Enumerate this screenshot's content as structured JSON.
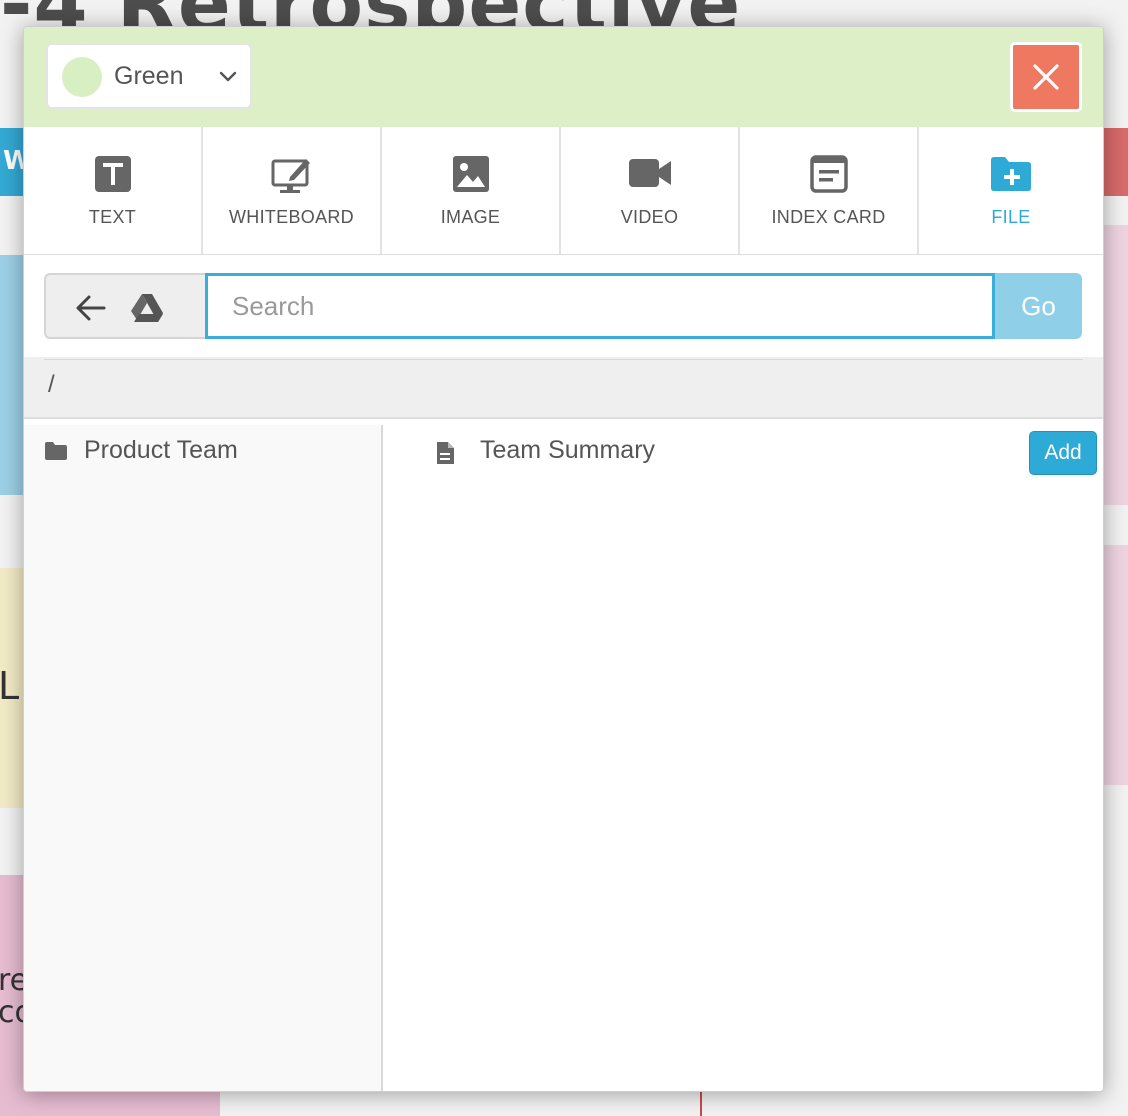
{
  "background": {
    "title_fragment": "-4 Retrospective",
    "column_fragment": "W",
    "card_fragment_1": "L",
    "card_fragment_2a": "re",
    "card_fragment_2b": "co"
  },
  "header": {
    "color_selector": {
      "selected": "Green",
      "swatch_color": "#d8efc4",
      "icon": "chevron-down-icon"
    },
    "close_icon": "close-icon",
    "header_color": "#dcefc7",
    "close_color": "#ef7861"
  },
  "toolbar": {
    "items": [
      {
        "label": "TEXT",
        "icon": "text-icon"
      },
      {
        "label": "WHITEBOARD",
        "icon": "whiteboard-icon"
      },
      {
        "label": "IMAGE",
        "icon": "image-icon"
      },
      {
        "label": "VIDEO",
        "icon": "video-icon"
      },
      {
        "label": "INDEX CARD",
        "icon": "index-card-icon"
      },
      {
        "label": "FILE",
        "icon": "folder-plus-icon",
        "active": true
      }
    ],
    "active_color": "#2eaad6"
  },
  "search": {
    "placeholder": "Search",
    "value": "",
    "go_label": "Go",
    "back_icon": "arrow-left-icon",
    "drive_icon": "google-drive-icon"
  },
  "path": {
    "current": "/"
  },
  "folders": [
    {
      "name": "Product Team",
      "icon": "folder-icon"
    }
  ],
  "files": [
    {
      "name": "Team Summary",
      "icon": "document-icon",
      "action": "Add"
    }
  ]
}
